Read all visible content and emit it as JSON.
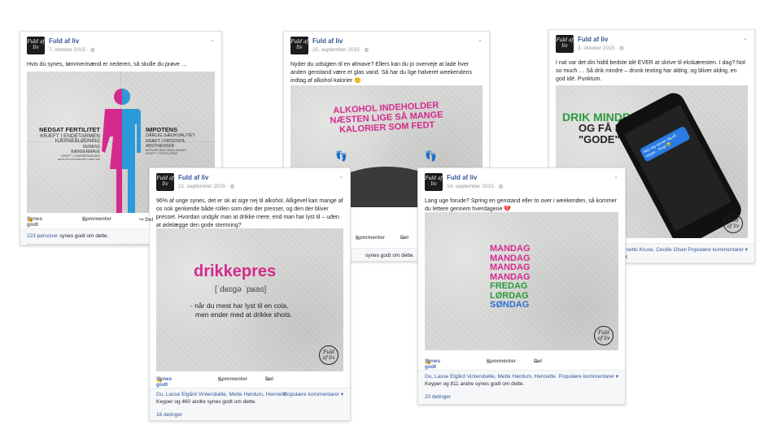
{
  "page_name": "Fuld af liv",
  "avatar_text": "Fuld af liv",
  "actions": {
    "like": "Synes godt om",
    "comment": "Kommenter",
    "share": "Del"
  },
  "posts": [
    {
      "date": "7. oktober 2015 · ",
      "text": "Hvis du synes, tømmermænd er nederen, så skulle du prøve …",
      "image": {
        "left_title": "NEDSAT FERTILITET",
        "left_lines": [
          "KRÆFT I ENDETARMEN",
          "HJERNEBLØDNING",
          "DEMENS",
          "BÆKKENMAVE",
          "KRÆFT I LIVMODERHALSEN",
          "MENSTRUATIONSFORSTYRRELSER"
        ],
        "right_title": "IMPOTENS",
        "right_lines": [
          "DÅRLIG SÆDKVALITET",
          "KRÆFT I PROSTATA",
          "ABSTINENSER",
          "BESVÆR MED VANDLADNING",
          "KRÆFT I TESTIKLERNE"
        ]
      },
      "likes": "223 personer synes godt om dette.",
      "likes_link": "223 personer"
    },
    {
      "date": "25. september 2015 · ",
      "text": "Nyder du udsigten til en ølmave? Ellers kan du jo overveje at lade hver anden genstand være et glas vand. Så har du lige halveret weekendens indtag af alkohol-kalorier 🙂",
      "image": {
        "lines": [
          "ALKOHOL INDEHOLDER",
          "NÆSTEN LIGE SÅ MANGE",
          "KALORIER SOM FEDT"
        ]
      },
      "likes": "synes godt om dette."
    },
    {
      "date": "3. oktober 2015 · ",
      "text": "I nat var det din hidtil bedste idé EVER at skrive til ekskæresten. I dag? Not so much … Så drik mindre – drunk texting har aldrig, og bliver aldrig, en god idé. Punktum.",
      "image": {
        "line1": "DRIK MINDRE",
        "line2": "OG FÅ FÆRRE",
        "line3": "\"GODE\" IDÉER",
        "bubble": "Hej! Jeg savner dig så meget... Ring! 😀"
      },
      "likes": "Anette Kruse, Cecilie Olsen",
      "likes2": "er.",
      "sort": "Populære kommentarer ▾"
    },
    {
      "date": "21. september 2015 · ",
      "text": "96% af unge synes, det er ok at sige nej til alkohol. Alligevel kan mange af os nok genkende både rollen som den der presser, og den der bliver presset. Hvordan undgår man at drikke mere, end man har lyst til – uden at ødelægge den gode stemning?",
      "image": {
        "word": "drikkepres",
        "phonetic": "[ˈdʁɛgə ˈpʁas]",
        "def1": "- når du mest har lyst til en cola,",
        "def2": "men ender med at drikke shots."
      },
      "likes_line1": "Du, Lasse Elgård Vintersbølle, Mette Hørdum, Henriette",
      "likes_line2": "Keyper og 460 andre synes godt om dette.",
      "sort": "Populære kommentarer ▾",
      "shares": "16 delinger"
    },
    {
      "date": "14. september 2015 · ",
      "text": "Lang uge forude? Spring en genstand eller to over i weekenden, så kommer du lettere gennem hverdagene 💔",
      "image": {
        "days": [
          {
            "label": "MANDAG",
            "color": "#d42a8e"
          },
          {
            "label": "MANDAG",
            "color": "#d42a8e"
          },
          {
            "label": "MANDAG",
            "color": "#d42a8e"
          },
          {
            "label": "MANDAG",
            "color": "#d42a8e"
          },
          {
            "label": "FREDAG",
            "color": "#2b9a3e"
          },
          {
            "label": "LØRDAG",
            "color": "#2b9a3e"
          },
          {
            "label": "SØNDAG",
            "color": "#2a6fc9"
          }
        ]
      },
      "likes_line1": "Du, Lasse Elgård Vintersbølle, Mette Hørdum, Henriette",
      "likes_line2": "Keyper og 811 andre synes godt om dette.",
      "sort": "Populære kommentarer ▾",
      "shares": "20 delinger"
    }
  ],
  "colors": {
    "pink": "#d42a8e",
    "green": "#2b9a3e",
    "blue": "#2a6fc9",
    "fb_blue": "#4267b2"
  }
}
